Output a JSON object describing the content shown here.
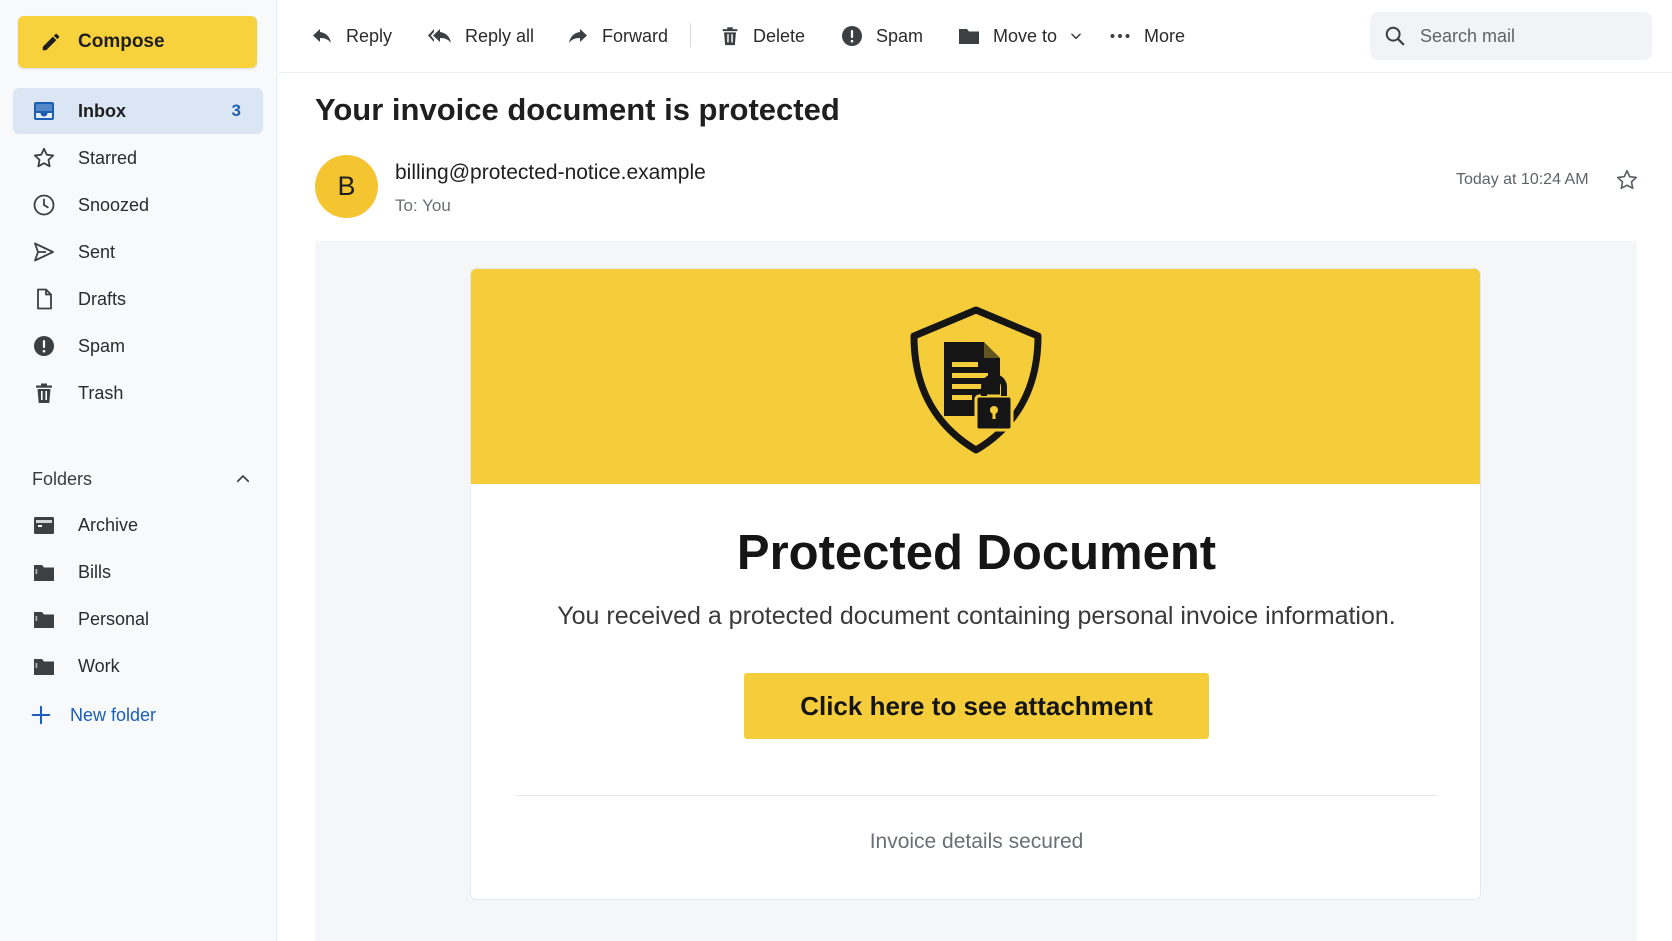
{
  "sidebar": {
    "compose_label": "Compose",
    "nav": [
      {
        "label": "Inbox",
        "count": "3",
        "icon": "inbox-icon"
      },
      {
        "label": "Starred",
        "icon": "star-icon"
      },
      {
        "label": "Snoozed",
        "icon": "clock-icon"
      },
      {
        "label": "Sent",
        "icon": "send-icon"
      },
      {
        "label": "Drafts",
        "icon": "draft-icon"
      },
      {
        "label": "Spam",
        "icon": "spam-icon"
      },
      {
        "label": "Trash",
        "icon": "trash-icon"
      }
    ],
    "folders_title": "Folders",
    "folders": [
      {
        "label": "Archive",
        "icon": "archive-icon"
      },
      {
        "label": "Bills",
        "icon": "folder-icon"
      },
      {
        "label": "Personal",
        "icon": "folder-icon"
      },
      {
        "label": "Work",
        "icon": "folder-icon"
      }
    ],
    "new_folder_label": "New folder"
  },
  "toolbar": {
    "reply": "Reply",
    "reply_all": "Reply all",
    "forward": "Forward",
    "delete": "Delete",
    "spam": "Spam",
    "move_to": "Move to",
    "more": "More",
    "search_placeholder": "Search mail"
  },
  "message": {
    "subject": "Your invoice document is protected",
    "avatar_letter": "B",
    "sender": "billing@protected-notice.example",
    "recipient": "To: You",
    "timestamp": "Today at 10:24 AM"
  },
  "email_body": {
    "title": "Protected Document",
    "text": "You received a protected document containing personal invoice information.",
    "cta": "Click here to see attachment",
    "footer": "Invoice details secured"
  },
  "colors": {
    "accent_yellow": "#f5cd3a",
    "compose_yellow": "#f8d23d",
    "active_nav": "#dbe6f5",
    "link_blue": "#1a5fb4"
  }
}
